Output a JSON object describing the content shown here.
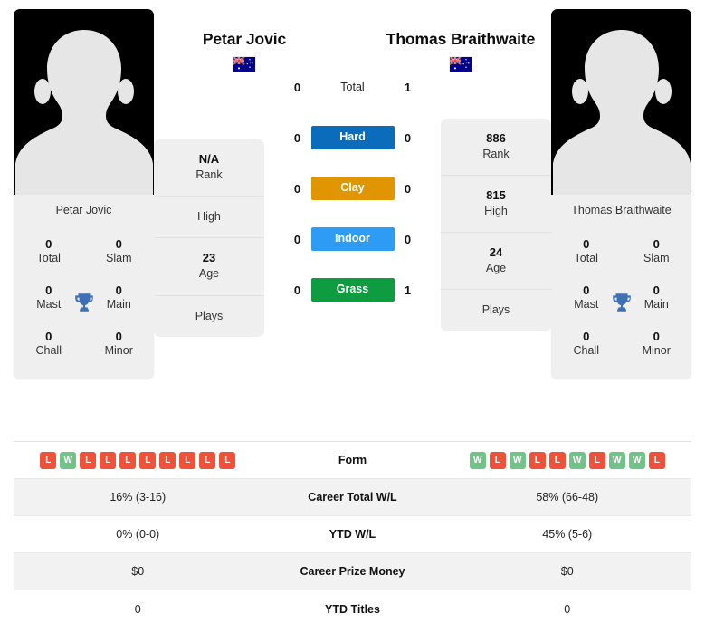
{
  "colors": {
    "hard": "#0a6cba",
    "clay": "#e09600",
    "indoor": "#2e9cf5",
    "grass": "#0f9b3f",
    "win": "#72c387",
    "loss": "#ef5139",
    "trophy": "#3f6fb5",
    "card_bg": "#efefef",
    "row_shade": "#f2f2f2"
  },
  "players": {
    "left": {
      "name": "Petar Jovic",
      "photo_caption": "Petar Jovic",
      "flag": "australia-flag",
      "titles": [
        {
          "num": "0",
          "label": "Total"
        },
        {
          "num": "0",
          "label": "Slam"
        },
        {
          "num": "0",
          "label": "Mast"
        },
        {
          "num": "0",
          "label": "Main"
        },
        {
          "num": "0",
          "label": "Chall"
        },
        {
          "num": "0",
          "label": "Minor"
        }
      ],
      "info": [
        {
          "value": "N/A",
          "label": "Rank"
        },
        {
          "value": "",
          "label": "High"
        },
        {
          "value": "23",
          "label": "Age"
        },
        {
          "value": "",
          "label": "Plays"
        }
      ],
      "form": [
        "L",
        "W",
        "L",
        "L",
        "L",
        "L",
        "L",
        "L",
        "L",
        "L"
      ],
      "career_total_wl": "16% (3-16)",
      "ytd_wl": "0% (0-0)",
      "career_prize_money": "$0",
      "ytd_titles": "0"
    },
    "right": {
      "name": "Thomas Braithwaite",
      "photo_caption": "Thomas Braithwaite",
      "flag": "australia-flag",
      "titles": [
        {
          "num": "0",
          "label": "Total"
        },
        {
          "num": "0",
          "label": "Slam"
        },
        {
          "num": "0",
          "label": "Mast"
        },
        {
          "num": "0",
          "label": "Main"
        },
        {
          "num": "0",
          "label": "Chall"
        },
        {
          "num": "0",
          "label": "Minor"
        }
      ],
      "info": [
        {
          "value": "886",
          "label": "Rank"
        },
        {
          "value": "815",
          "label": "High"
        },
        {
          "value": "24",
          "label": "Age"
        },
        {
          "value": "",
          "label": "Plays"
        }
      ],
      "form": [
        "W",
        "L",
        "W",
        "L",
        "L",
        "W",
        "L",
        "W",
        "W",
        "L"
      ],
      "career_total_wl": "58% (66-48)",
      "ytd_wl": "45% (5-6)",
      "career_prize_money": "$0",
      "ytd_titles": "0"
    }
  },
  "head_to_head": [
    {
      "label": "Total",
      "left": "0",
      "right": "1",
      "badge": false,
      "color": ""
    },
    {
      "label": "Hard",
      "left": "0",
      "right": "0",
      "badge": true,
      "color": "#0a6cba"
    },
    {
      "label": "Clay",
      "left": "0",
      "right": "0",
      "badge": true,
      "color": "#e09600"
    },
    {
      "label": "Indoor",
      "left": "0",
      "right": "0",
      "badge": true,
      "color": "#2e9cf5"
    },
    {
      "label": "Grass",
      "left": "0",
      "right": "1",
      "badge": true,
      "color": "#0f9b3f"
    }
  ],
  "stats_table": [
    {
      "label": "Form",
      "left": "",
      "right": "",
      "type": "form",
      "shaded": false
    },
    {
      "label": "Career Total W/L",
      "left": "16% (3-16)",
      "right": "58% (66-48)",
      "type": "text",
      "shaded": true
    },
    {
      "label": "YTD W/L",
      "left": "0% (0-0)",
      "right": "45% (5-6)",
      "type": "text",
      "shaded": false
    },
    {
      "label": "Career Prize Money",
      "left": "$0",
      "right": "$0",
      "type": "text",
      "shaded": true
    },
    {
      "label": "YTD Titles",
      "left": "0",
      "right": "0",
      "type": "text",
      "shaded": false
    }
  ]
}
